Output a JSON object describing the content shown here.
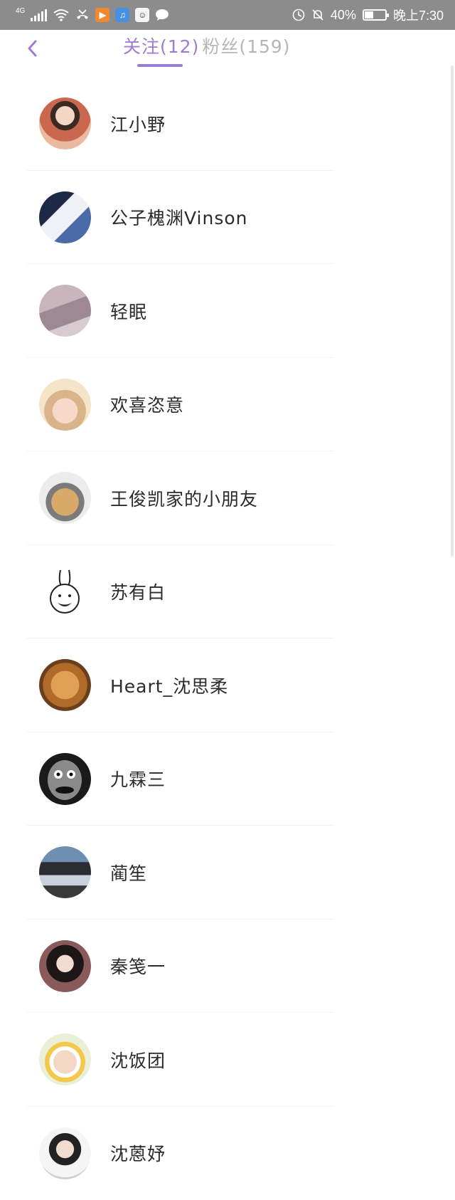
{
  "status_bar": {
    "network": "4G",
    "battery_percent": "40%",
    "time": "晚上7:30"
  },
  "nav": {
    "back_icon": "chevron-left-icon",
    "tabs": [
      {
        "label": "关注(12)",
        "active": true
      },
      {
        "label": "粉丝(159)",
        "active": false
      }
    ]
  },
  "follow_list": [
    {
      "name": "江小野"
    },
    {
      "name": "公子槐渊Vinson"
    },
    {
      "name": "轻眠"
    },
    {
      "name": "欢喜恣意"
    },
    {
      "name": "王俊凯家的小朋友"
    },
    {
      "name": "苏有白"
    },
    {
      "name": "Heart_沈思柔"
    },
    {
      "name": "九霖三"
    },
    {
      "name": "蔺笙"
    },
    {
      "name": "秦笺一"
    },
    {
      "name": "沈饭团"
    },
    {
      "name": "沈蒽妤"
    }
  ],
  "colors": {
    "accent": "#a07cd0",
    "status_bar_bg": "#8c8c8c",
    "inactive_tab": "#b6b6b6"
  }
}
